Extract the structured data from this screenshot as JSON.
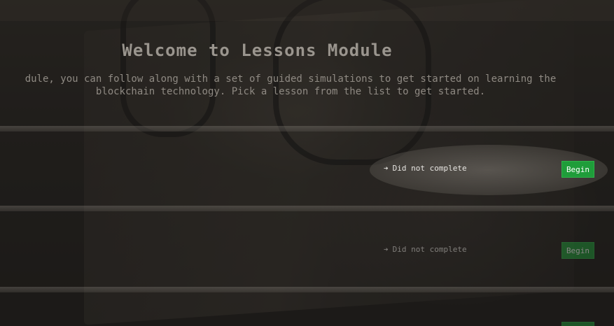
{
  "header": {
    "title": "Welcome to Lessons Module",
    "intro": "dule, you can follow along with a set of guided simulations to get started on learning the\nblockchain technology. Pick a lesson from the list to get started."
  },
  "lessons": [
    {
      "status": "Did not complete",
      "button_label": "Begin"
    },
    {
      "status": "Did not complete",
      "button_label": "Begin"
    }
  ],
  "colors": {
    "button_bg": "#1f9d3a",
    "status_text": "#e8e6e2"
  },
  "icons": {
    "status_arrow": "arrow-right-icon"
  }
}
